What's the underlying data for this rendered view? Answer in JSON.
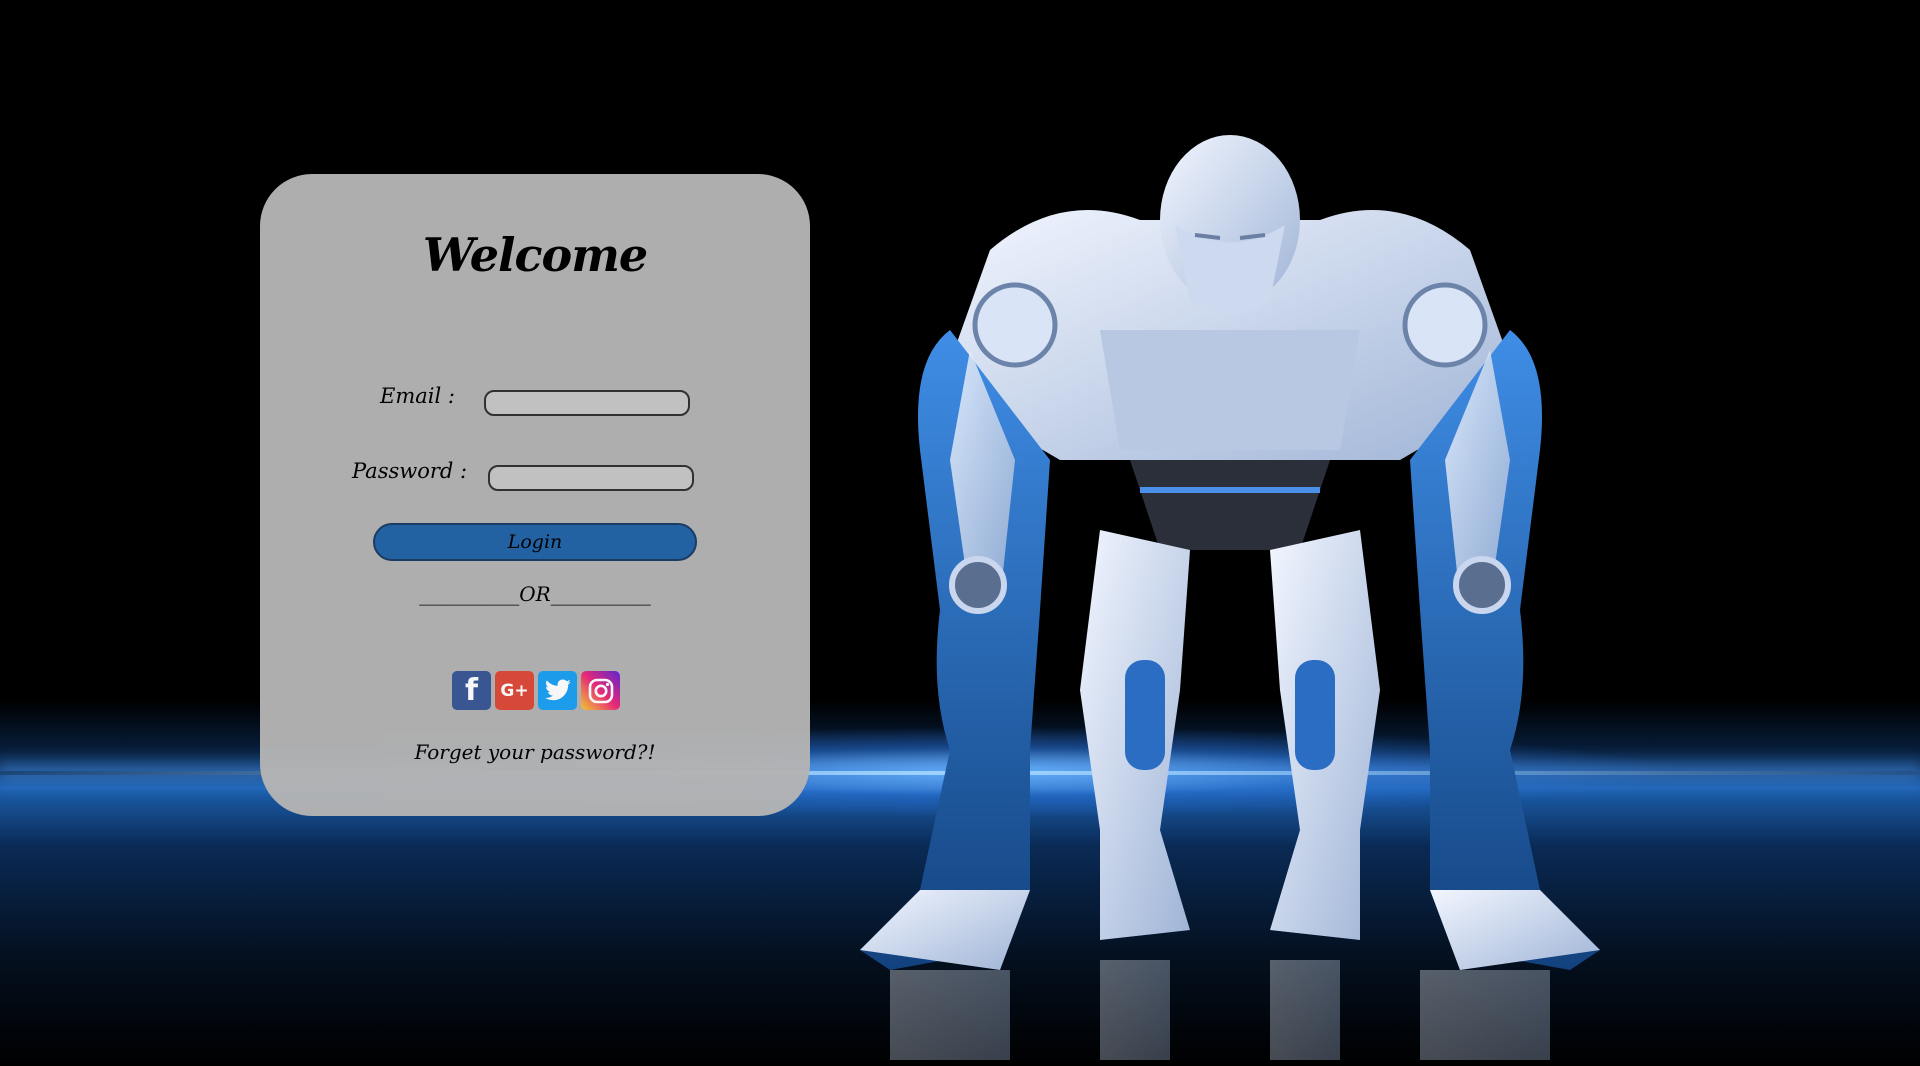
{
  "card": {
    "title": "Welcome",
    "email_label": "Email :",
    "email_value": "",
    "password_label": "Password :",
    "password_value": "",
    "login_label": "Login",
    "separator_text": "__________OR__________",
    "forgot_text": "Forget your password?!"
  },
  "social": [
    {
      "name": "facebook",
      "glyph": "f"
    },
    {
      "name": "google-plus",
      "glyph": "G+"
    },
    {
      "name": "twitter",
      "glyph": ""
    },
    {
      "name": "instagram",
      "glyph": ""
    }
  ],
  "colors": {
    "card_bg": "#b4b4b4",
    "login_button": "#2566a8",
    "facebook": "#3b5998",
    "google_plus": "#dd4b39",
    "twitter": "#1da1f2"
  }
}
